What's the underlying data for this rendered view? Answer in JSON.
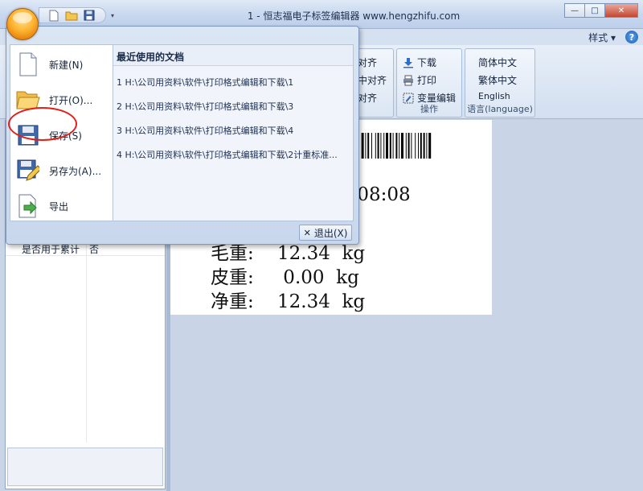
{
  "window": {
    "title": "1 - 恒志福电子标签编辑器  www.hengzhifu.com",
    "minimize": "—",
    "maximize": "□",
    "close": "✕"
  },
  "quick_access": {
    "icons": [
      "new-doc-icon",
      "open-folder-icon",
      "save-disk-icon"
    ],
    "dropdown": "▾"
  },
  "ribbon": {
    "style_menu": "样式 ▾",
    "help_icon": "?",
    "align_group": {
      "items": [
        "对齐",
        "中对齐",
        "对齐"
      ]
    },
    "operation_group": {
      "items": [
        "下载",
        "打印",
        "变量编辑"
      ],
      "label": "操作"
    },
    "language_group": {
      "items": [
        "简体中文",
        "繁体中文",
        "English"
      ],
      "label": "语言(language)"
    }
  },
  "app_menu": {
    "commands": [
      {
        "label": "新建(N)",
        "icon": "new-document-icon"
      },
      {
        "label": "打开(O)...",
        "icon": "open-folder-icon"
      },
      {
        "label": "保存(S)",
        "icon": "save-disk-icon"
      },
      {
        "label": "另存为(A)...",
        "icon": "save-as-icon"
      },
      {
        "label": "导出",
        "icon": "export-icon"
      }
    ],
    "recent_header": "最近使用的文档",
    "recent_docs": [
      "1 H:\\公司用资料\\软件\\打印格式编辑和下载\\1",
      "2 H:\\公司用资料\\软件\\打印格式编辑和下载\\3",
      "3 H:\\公司用资料\\软件\\打印格式编辑和下载\\4",
      "4 H:\\公司用资料\\软件\\打印格式编辑和下载\\2计重标准..."
    ],
    "exit_label": "退出(X)"
  },
  "properties": {
    "row_name": "是否用于累计",
    "row_value": "否"
  },
  "label": {
    "time": "8:08:08",
    "gross": "毛重:    12.34  kg",
    "tare": "皮重:     0.00  kg",
    "net": "净重:    12.34  kg"
  }
}
